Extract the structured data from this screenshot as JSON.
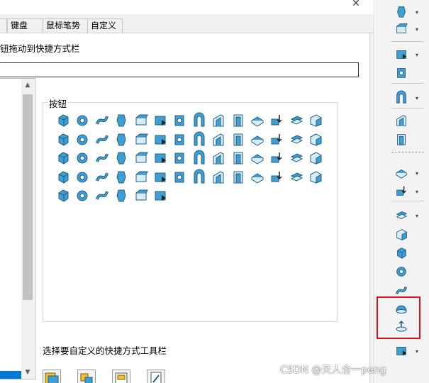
{
  "tabs": [
    {
      "label": "键盘"
    },
    {
      "label": "鼠标笔势"
    },
    {
      "label": "自定义"
    }
  ],
  "panel": {
    "instruction": "钮拖动到快捷方式栏",
    "buttons_group_label": "按钮",
    "choose_toolbar_label": "选择要自定义的快捷方式工具栏"
  },
  "window": {
    "close_symbol": "✕"
  },
  "colors": {
    "icon_blue": "#3f9fd2",
    "icon_dark": "#1f5f86",
    "selection": "#0078d7",
    "highlight_box": "#e0101a"
  },
  "button_icons": [
    "extruded-boss-icon",
    "revolved-boss-icon",
    "swept-boss-icon",
    "lofted-boss-icon",
    "boundary-boss-icon",
    "extruded-cut-icon",
    "hole-wizard-icon",
    "revolved-cut-icon",
    "swept-cut-icon",
    "lofted-cut-icon",
    "boundary-cut-icon",
    "fillet-icon",
    "chamfer-icon",
    "rib-icon",
    "shell-icon",
    "draft-icon",
    "wrap-icon",
    "dome-icon",
    "intersect-icon",
    "thicken-icon",
    "cut-with-surface-icon",
    "variable-fillet-icon",
    "face-fillet-icon",
    "full-round-fillet-icon",
    "cosmetic-thread-icon",
    "indent-icon",
    "deform-icon",
    "free-form-icon",
    "flex-icon",
    "move-face-icon",
    "combine-icon",
    "split-icon",
    "mirror-icon",
    "scale-icon",
    "linear-pattern-icon",
    "circular-pattern-icon",
    "curve-pattern-icon",
    "sketch-pattern-icon",
    "table-pattern-icon",
    "fill-pattern-icon",
    "variable-pattern-icon",
    "mirror-body-icon",
    "delete-body-icon",
    "library-feature-icon",
    "insert-part-icon",
    "join-icon",
    "move-body-icon",
    "copy-body-icon",
    "delete-face-icon",
    "replace-face-icon",
    "offset-surface-icon",
    "knit-surface-icon",
    "trim-surface-icon",
    "extend-surface-icon",
    "untrim-surface-icon",
    "split-line-icon",
    "check-icon",
    "3d-sketch-grid-icon",
    "feature-works-icon",
    "instant3d-icon",
    "simplify-icon",
    "freeze-bar-icon"
  ],
  "toolbar_icons": [
    "grid-pattern-icon",
    "tool-arrow-icon",
    "reference-eye-icon",
    "curves-icon",
    "view-icon",
    "instant3d-lightning-icon",
    "sketch-ruler-icon",
    "extrude-icon",
    "hole-icon",
    "shell-box-icon",
    "rib-icon",
    "draft-face-icon",
    "section-icon",
    "fillet-body-icon",
    "dome-icon",
    "indent-icon",
    "grid-pattern-bottom-icon"
  ],
  "watermark": "CSDN @天人合一peng"
}
